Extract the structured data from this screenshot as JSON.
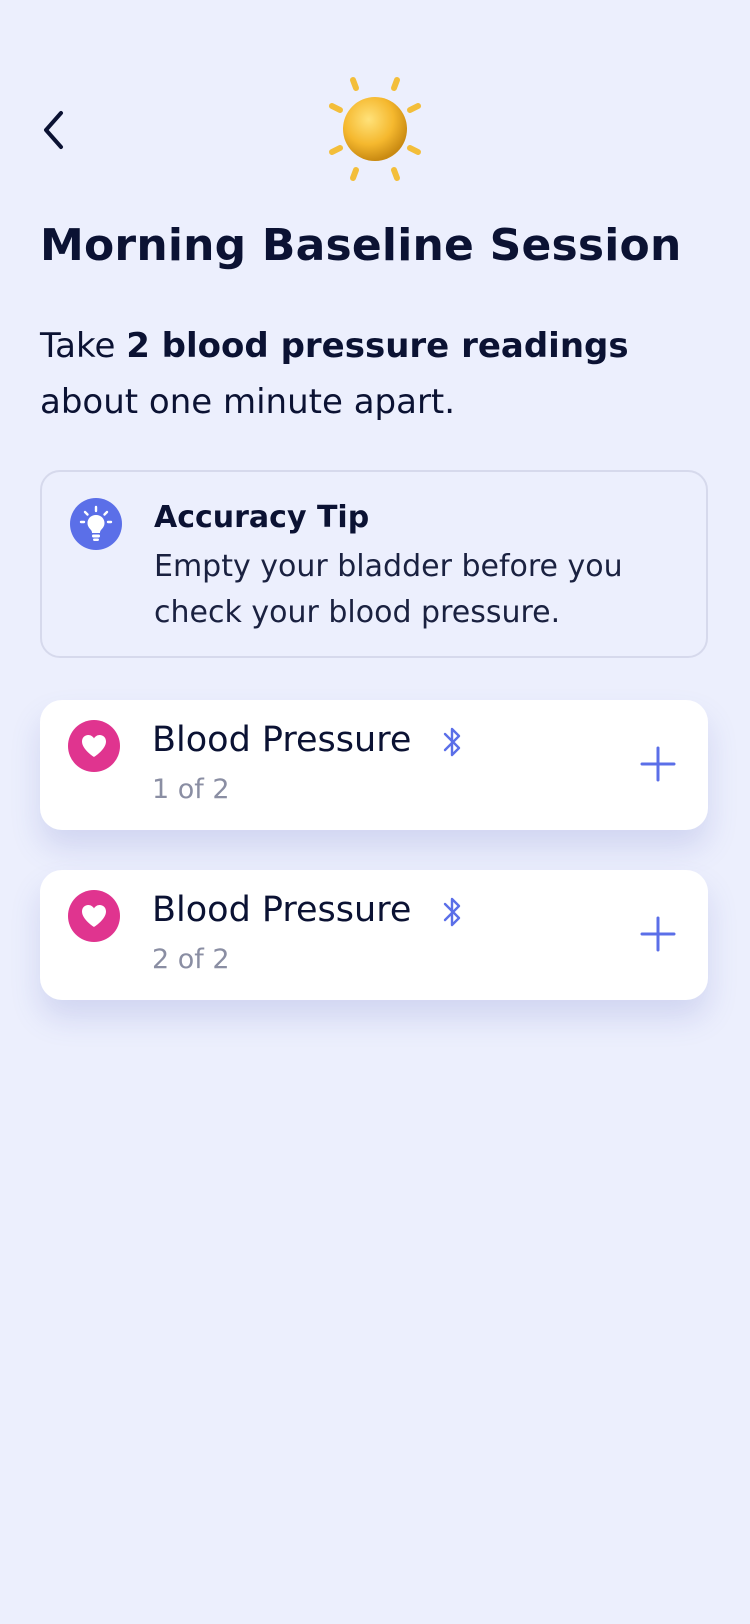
{
  "header": {
    "back_icon": "chevron-left-icon",
    "sun_icon": "sun-icon"
  },
  "page": {
    "title": "Morning Baseline Session",
    "instruction_prefix": "Take ",
    "instruction_bold": "2 blood pressure readings",
    "instruction_suffix": " about one minute apart."
  },
  "tip": {
    "icon": "lightbulb-icon",
    "title": "Accuracy Tip",
    "body": "Empty your bladder before you check your blood pressure."
  },
  "readings": [
    {
      "title": "Blood Pressure",
      "count": "1 of 2",
      "icon": "heart-icon",
      "connection_icon": "bluetooth-icon",
      "action_icon": "plus-icon"
    },
    {
      "title": "Blood Pressure",
      "count": "2 of 2",
      "icon": "heart-icon",
      "connection_icon": "bluetooth-icon",
      "action_icon": "plus-icon"
    }
  ],
  "colors": {
    "background": "#ECEFFD",
    "text": "#0B1233",
    "accent": "#5B6FE8",
    "heart": "#E0348F",
    "sun": "#F5B82E",
    "muted": "#8A8EA3"
  }
}
